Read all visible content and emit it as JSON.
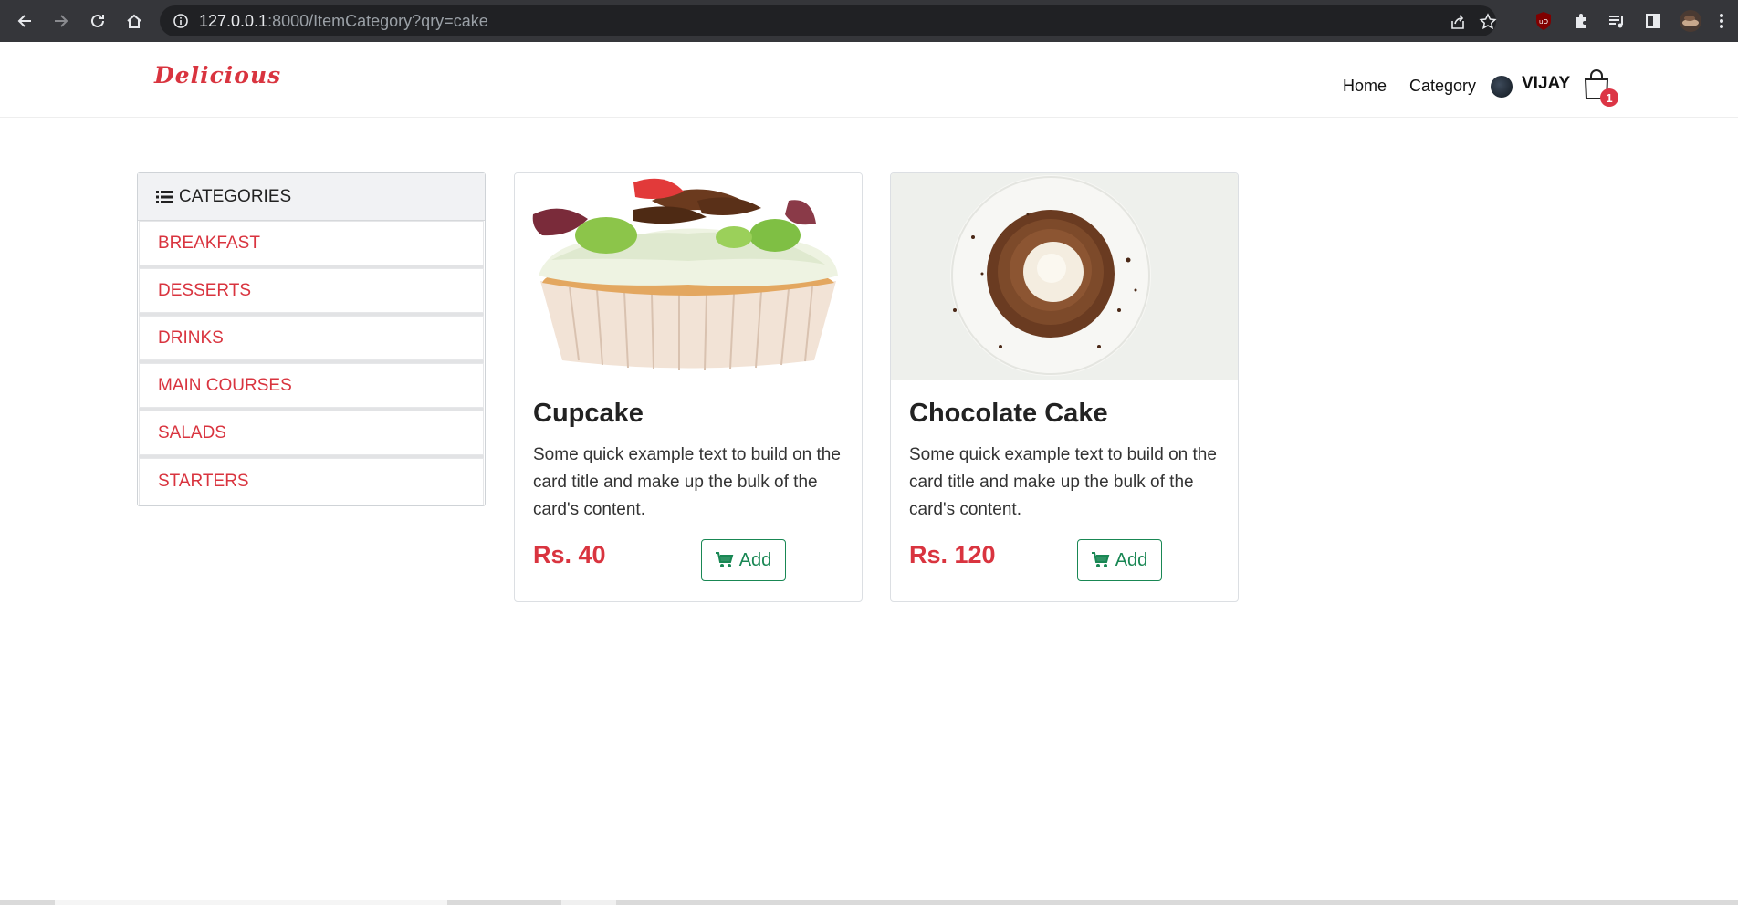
{
  "browser": {
    "url_host": "127.0.0.1",
    "url_path": ":8000/ItemCategory?qry=cake"
  },
  "header": {
    "brand": "Delicious",
    "nav": [
      "Home",
      "Category"
    ],
    "user": "VIJAY",
    "cart_count": "1"
  },
  "sidebar": {
    "title": "CATEGORIES",
    "items": [
      "BREAKFAST",
      "DESSERTS",
      "DRINKS",
      "MAIN COURSES",
      "SALADS",
      "STARTERS"
    ]
  },
  "cards": [
    {
      "title": "Cupcake",
      "text": "Some quick example text to build on the card title and make up the bulk of the card's content.",
      "price": "Rs. 40",
      "button": "Add"
    },
    {
      "title": "Chocolate Cake",
      "text": "Some quick example text to build on the card title and make up the bulk of the card's content.",
      "price": "Rs. 120",
      "button": "Add"
    }
  ],
  "colors": {
    "accent": "#d9343f",
    "success": "#198754",
    "chrome": "#35363a"
  }
}
